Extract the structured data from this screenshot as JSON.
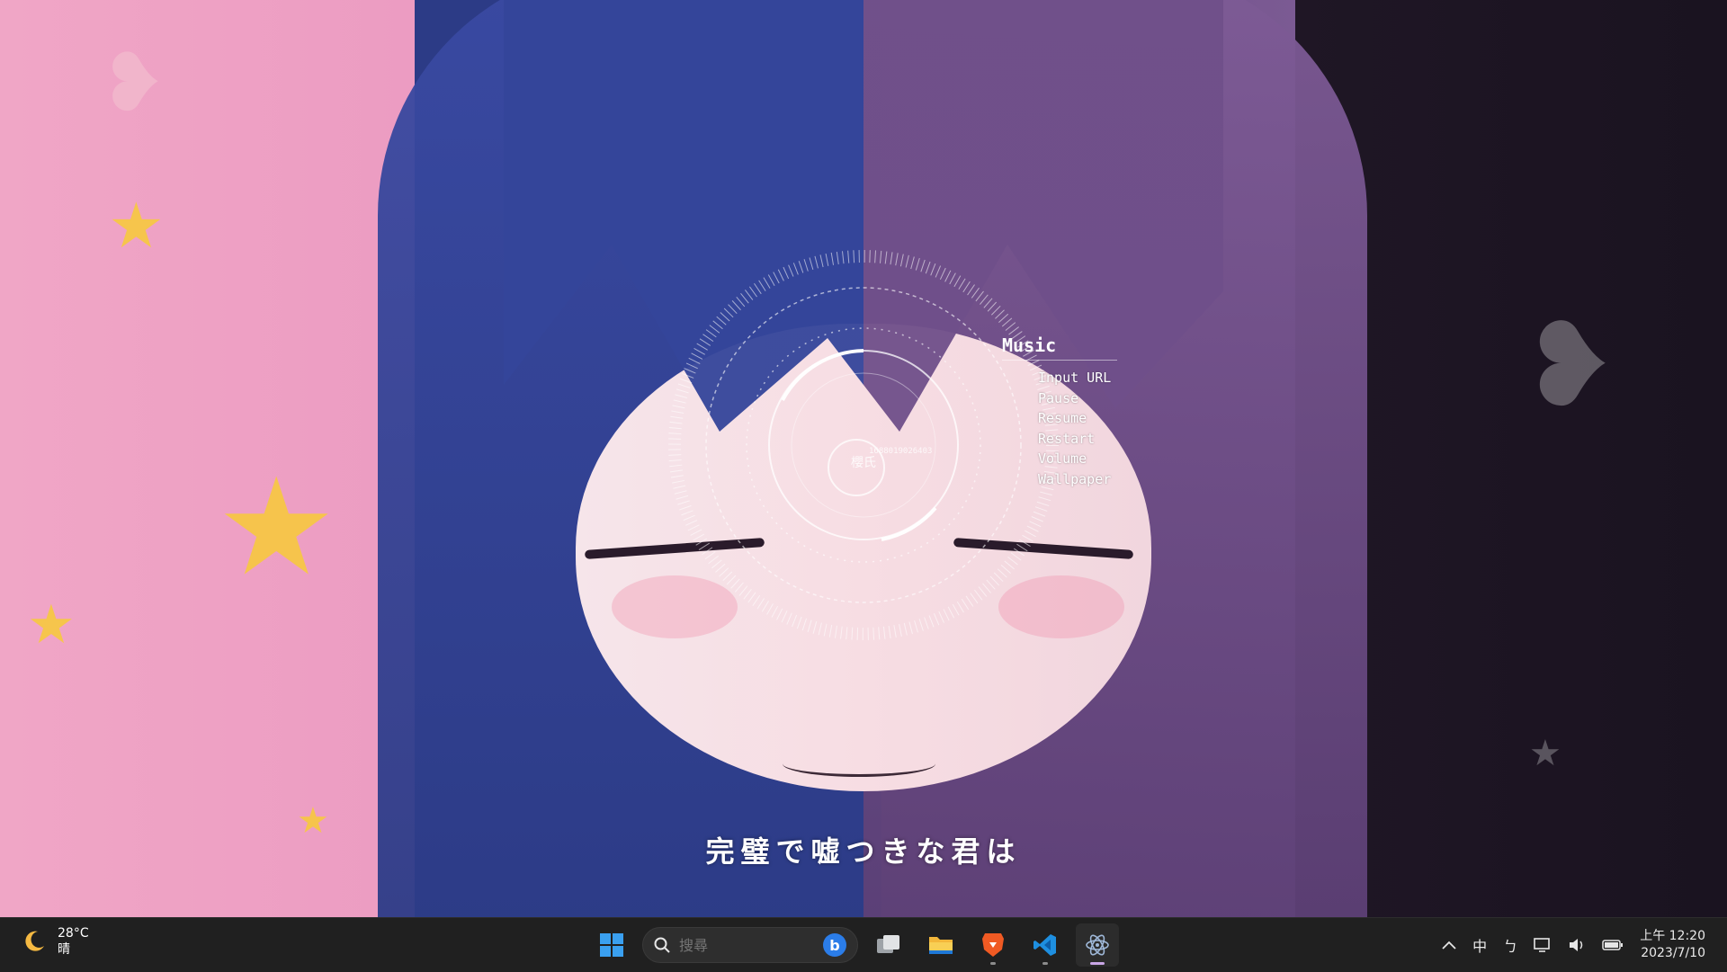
{
  "wallpaper": {
    "description_colors": {
      "left": "#ec9cc2",
      "center_left": "#2c3b86",
      "center_right": "#6a4b86",
      "right": "#1a1320"
    }
  },
  "hud": {
    "label": "櫻氏",
    "number": "1688019026403"
  },
  "music_menu": {
    "title": "Music",
    "items": [
      "Input URL",
      "Pause",
      "Resume",
      "Restart",
      "Volume",
      "Wallpaper"
    ]
  },
  "lyrics": "完璧で嘘つきな君は",
  "taskbar": {
    "weather": {
      "temperature": "28°C",
      "condition": "晴",
      "icon": "moon-icon"
    },
    "search": {
      "placeholder": "搜尋"
    },
    "apps": [
      {
        "name": "start-icon"
      },
      {
        "name": "task-view-icon"
      },
      {
        "name": "file-explorer-icon"
      },
      {
        "name": "brave-browser-icon"
      },
      {
        "name": "vscode-icon"
      },
      {
        "name": "electron-app-icon"
      }
    ],
    "tray": {
      "ime": "中",
      "ime_mode": "ㄅ",
      "time": "上午 12:20",
      "date": "2023/7/10"
    },
    "colors": {
      "bar": "#202020",
      "accent": "#2b7de9"
    }
  }
}
